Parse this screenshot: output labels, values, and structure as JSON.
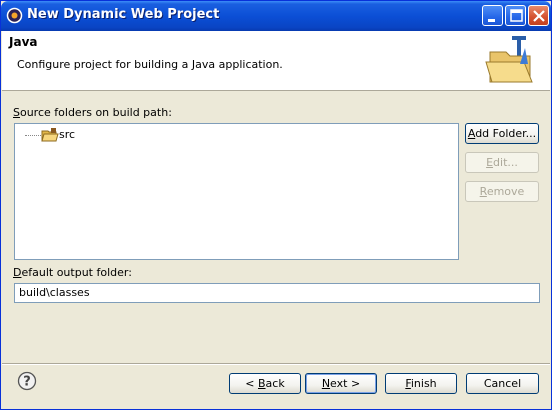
{
  "window": {
    "title": "New Dynamic Web Project"
  },
  "header": {
    "title": "Java",
    "description": "Configure project for building a Java application."
  },
  "source": {
    "label_prefix": "",
    "label_mnemonic": "S",
    "label_rest": "ource folders on build path:",
    "folders": [
      "src"
    ]
  },
  "buttons": {
    "add_folder": {
      "mnemonic": "A",
      "rest": "dd Folder..."
    },
    "edit": {
      "mnemonic": "E",
      "rest": "dit..."
    },
    "remove": {
      "mnemonic": "R",
      "rest": "emove"
    }
  },
  "output": {
    "label_mnemonic": "D",
    "label_rest": "efault output folder:",
    "value": "build\\classes"
  },
  "footer": {
    "back": {
      "prefix": "< ",
      "mnemonic": "B",
      "rest": "ack"
    },
    "next": {
      "mnemonic": "N",
      "rest": "ext >"
    },
    "finish": {
      "mnemonic": "F",
      "rest": "inish"
    },
    "cancel": "Cancel"
  },
  "icons": {
    "title": "eclipse-icon",
    "header": "java-folder-wizard-icon",
    "folder": "source-folder-icon",
    "help": "help-icon"
  },
  "colors": {
    "titlebar": "#0b4fd6",
    "dialog_bg": "#ece9d8",
    "field_border": "#7f9db9"
  }
}
